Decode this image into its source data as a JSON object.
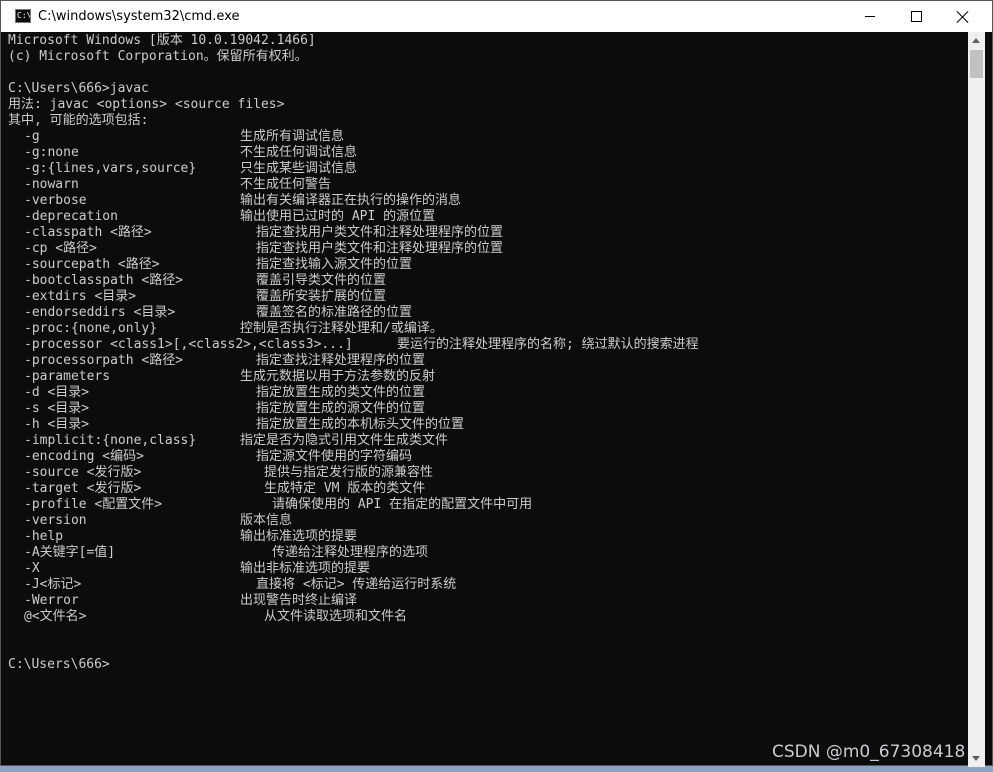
{
  "window": {
    "title": "C:\\windows\\system32\\cmd.exe",
    "app_icon_text": "C:\\"
  },
  "console": {
    "header_lines": [
      "Microsoft Windows [版本 10.0.19042.1466]",
      "(c) Microsoft Corporation。保留所有权利。",
      "",
      "C:\\Users\\666>javac",
      "用法: javac <options> <source files>",
      "其中, 可能的选项包括:"
    ],
    "options": [
      {
        "opt": "-g",
        "desc": "生成所有调试信息"
      },
      {
        "opt": "-g:none",
        "desc": "不生成任何调试信息"
      },
      {
        "opt": "-g:{lines,vars,source}",
        "desc": "只生成某些调试信息"
      },
      {
        "opt": "-nowarn",
        "desc": "不生成任何警告"
      },
      {
        "opt": "-verbose",
        "desc": "输出有关编译器正在执行的操作的消息"
      },
      {
        "opt": "-deprecation",
        "desc": "输出使用已过时的 API 的源位置"
      },
      {
        "opt": "-classpath <路径>",
        "desc": "指定查找用户类文件和注释处理程序的位置"
      },
      {
        "opt": "-cp <路径>",
        "desc": "指定查找用户类文件和注释处理程序的位置"
      },
      {
        "opt": "-sourcepath <路径>",
        "desc": "指定查找输入源文件的位置"
      },
      {
        "opt": "-bootclasspath <路径>",
        "desc": "覆盖引导类文件的位置"
      },
      {
        "opt": "-extdirs <目录>",
        "desc": "覆盖所安装扩展的位置"
      },
      {
        "opt": "-endorseddirs <目录>",
        "desc": "覆盖签名的标准路径的位置"
      },
      {
        "opt": "-proc:{none,only}",
        "desc": "控制是否执行注释处理和/或编译。"
      },
      {
        "opt": "-processor <class1>[,<class2>,<class3>...]",
        "desc": "要运行的注释处理程序的名称; 绕过默认的搜索进程"
      },
      {
        "opt": "-processorpath <路径>",
        "desc": "指定查找注释处理程序的位置"
      },
      {
        "opt": "-parameters",
        "desc": "生成元数据以用于方法参数的反射"
      },
      {
        "opt": "-d <目录>",
        "desc": "指定放置生成的类文件的位置"
      },
      {
        "opt": "-s <目录>",
        "desc": "指定放置生成的源文件的位置"
      },
      {
        "opt": "-h <目录>",
        "desc": "指定放置生成的本机标头文件的位置"
      },
      {
        "opt": "-implicit:{none,class}",
        "desc": "指定是否为隐式引用文件生成类文件"
      },
      {
        "opt": "-encoding <编码>",
        "desc": "指定源文件使用的字符编码"
      },
      {
        "opt": "-source <发行版>",
        "desc": "提供与指定发行版的源兼容性"
      },
      {
        "opt": "-target <发行版>",
        "desc": "生成特定 VM 版本的类文件"
      },
      {
        "opt": "-profile <配置文件>",
        "desc": "请确保使用的 API 在指定的配置文件中可用"
      },
      {
        "opt": "-version",
        "desc": "版本信息"
      },
      {
        "opt": "-help",
        "desc": "输出标准选项的提要"
      },
      {
        "opt": "-A关键字[=值]",
        "desc": "传递给注释处理程序的选项"
      },
      {
        "opt": "-X",
        "desc": "输出非标准选项的提要"
      },
      {
        "opt": "-J<标记>",
        "desc": "直接将 <标记> 传递给运行时系统"
      },
      {
        "opt": "-Werror",
        "desc": "出现警告时终止编译"
      },
      {
        "opt": "@<文件名>",
        "desc": "从文件读取选项和文件名"
      }
    ],
    "prompt": "C:\\Users\\666>"
  },
  "watermark": "CSDN @m0_67308418",
  "colors": {
    "console_bg": "#0c0c0c",
    "console_text": "#cccccc",
    "titlebar_bg": "#ffffff"
  }
}
